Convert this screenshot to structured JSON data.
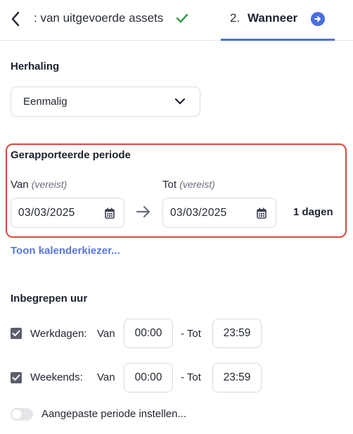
{
  "header": {
    "step1_label": ": van uitgevoerde assets",
    "step2_number": "2.",
    "step2_label": "Wanneer"
  },
  "herhaling": {
    "title": "Herhaling",
    "selected": "Eenmalig"
  },
  "periode": {
    "title": "Gerapporteerde periode",
    "van_label": "Van",
    "tot_label": "Tot",
    "required_text": "(vereist)",
    "van_value": "03/03/2025",
    "tot_value": "03/03/2025",
    "days_text": "1 dagen",
    "show_calendar_link": "Toon kalenderkiezer..."
  },
  "uren": {
    "title": "Inbegrepen uur",
    "werkdagen": {
      "label": "Werkdagen:",
      "van": "Van",
      "tot": "- Tot",
      "from": "00:00",
      "to": "23:59",
      "checked": true
    },
    "weekends": {
      "label": "Weekends:",
      "van": "Van",
      "tot": "- Tot",
      "from": "00:00",
      "to": "23:59",
      "checked": true
    },
    "custom_label": "Aangepaste periode instellen...",
    "custom_enabled": false
  },
  "colors": {
    "accent": "#4a6ee0",
    "link": "#5878da",
    "highlight_border": "#d64a3c",
    "check": "#3a9a4a"
  },
  "icons": [
    "back-chevron-icon",
    "check-icon",
    "arrow-right-circle-icon",
    "chevron-down-icon",
    "calendar-icon",
    "arrow-right-icon",
    "checkbox-check-icon"
  ]
}
